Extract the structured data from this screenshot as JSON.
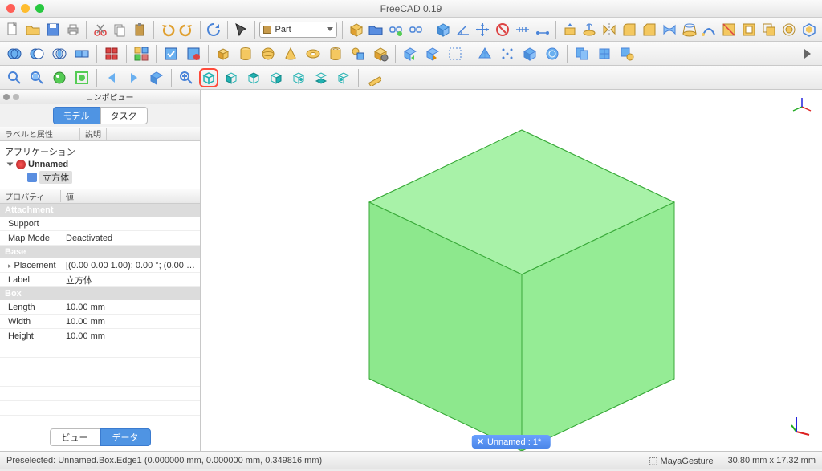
{
  "window": {
    "title": "FreeCAD 0.19"
  },
  "toolbar": {
    "workbench_selector": "Part"
  },
  "panel": {
    "title": "コンポビュー",
    "tabs": {
      "model": "モデル",
      "task": "タスク"
    },
    "tree_headers": {
      "label": "ラベルと属性",
      "desc": "説明"
    },
    "tree": {
      "app": "アプリケーション",
      "doc": "Unnamed",
      "obj": "立方体"
    },
    "prop_headers": {
      "property": "プロパティ",
      "value": "値"
    },
    "groups": {
      "attachment": "Attachment",
      "base": "Base",
      "box": "Box"
    },
    "rows": {
      "support": {
        "k": "Support",
        "v": ""
      },
      "mapmode": {
        "k": "Map Mode",
        "v": "Deactivated"
      },
      "placement": {
        "k": "Placement",
        "v": "[(0.00 0.00 1.00); 0.00 °; (0.00 mm ..."
      },
      "label": {
        "k": "Label",
        "v": "立方体"
      },
      "length": {
        "k": "Length",
        "v": "10.00 mm"
      },
      "width": {
        "k": "Width",
        "v": "10.00 mm"
      },
      "height": {
        "k": "Height",
        "v": "10.00 mm"
      }
    },
    "bottom_tabs": {
      "view": "ビュー",
      "data": "データ"
    }
  },
  "viewport": {
    "doc_tab": "Unnamed : 1*",
    "doc_tab_close": "✕"
  },
  "status": {
    "left": "Preselected: Unnamed.Box.Edge1 (0.000000 mm, 0.000000 mm, 0.349816 mm)",
    "nav": "MayaGesture",
    "dims": "30.80 mm x 17.32 mm"
  }
}
